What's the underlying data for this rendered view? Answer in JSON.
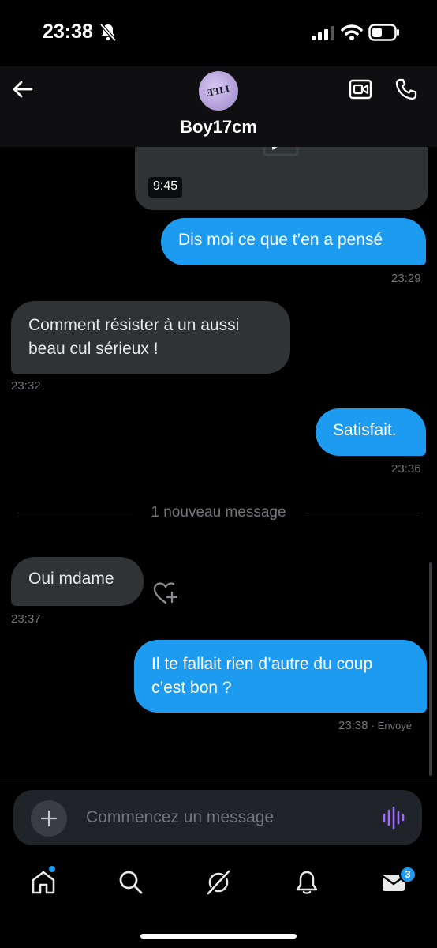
{
  "status_bar": {
    "time": "23:38"
  },
  "header": {
    "contact_name": "Boy17cm",
    "avatar_text": "LIFE"
  },
  "media": {
    "duration": "9:45"
  },
  "messages": [
    {
      "direction": "outgoing",
      "text": "Dis moi ce que t’en a pensé",
      "time": "23:29"
    },
    {
      "direction": "incoming",
      "text_lines": [
        "Comment résister à un aussi",
        "beau cul sérieux !"
      ],
      "time": "23:32"
    },
    {
      "direction": "outgoing",
      "text": "Satisfait.",
      "time": "23:36"
    },
    {
      "direction": "incoming",
      "text": "Oui mdame",
      "time": "23:37"
    },
    {
      "direction": "outgoing",
      "text_lines": [
        "Il te fallait rien d’autre du coup",
        "c’est bon ?"
      ],
      "time": "23:38",
      "status": "· Envoyé"
    }
  ],
  "new_messages_divider": "1 nouveau message",
  "compose": {
    "placeholder": "Commencez un message"
  },
  "nav": {
    "items": [
      "home-icon",
      "search-icon",
      "grok-icon",
      "notifications-icon",
      "messages-icon"
    ],
    "messages_badge": "3"
  },
  "colors": {
    "accent": "#1d9bf0",
    "incoming_bubble": "#2f3336",
    "voice_icon": "#9c6bff"
  }
}
